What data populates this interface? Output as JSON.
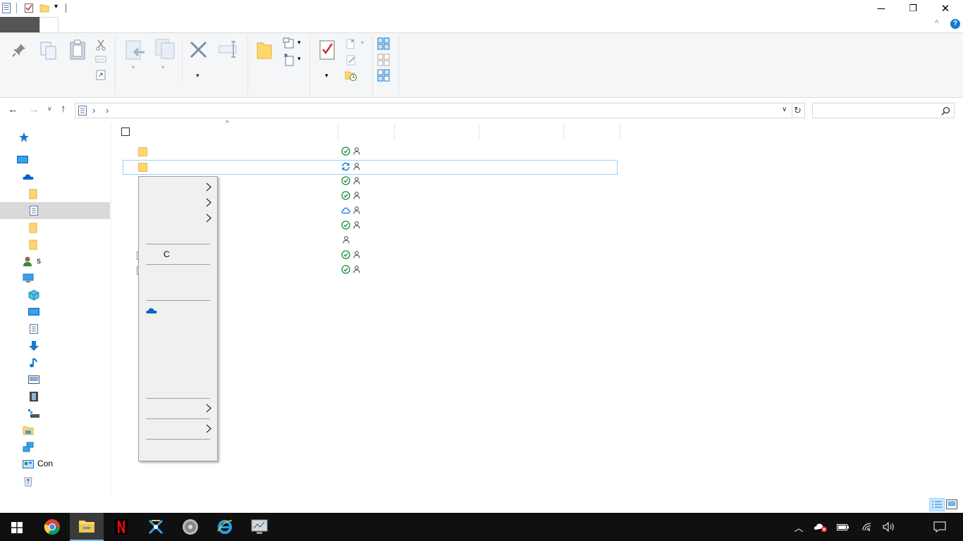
{
  "window": {
    "minimize_glyph": "─",
    "restore_glyph": "❐",
    "close_glyph": "✕",
    "help_glyph": "?",
    "ribbon_collapse_glyph": "^"
  },
  "address": {
    "chevron1": "›",
    "chevron2": "›",
    "dropdown_glyph": "∨",
    "refresh_glyph": "↻"
  },
  "nav": {
    "back_glyph": "←",
    "forward_glyph": "→",
    "recent_glyph": "∨",
    "up_glyph": "↑",
    "items": [
      {
        "label": "",
        "icon": "quick-access-pin-icon"
      },
      {
        "label": "",
        "icon": "desktop-icon"
      },
      {
        "label": "",
        "icon": "onedrive-icon"
      },
      {
        "label": "",
        "icon": "folder-icon"
      },
      {
        "label": "",
        "icon": "document-icon"
      },
      {
        "label": "",
        "icon": "folder-icon"
      },
      {
        "label": "",
        "icon": "folder-icon"
      },
      {
        "label": "s",
        "icon": "user-icon"
      },
      {
        "label": "",
        "icon": "this-pc-icon"
      },
      {
        "label": "",
        "icon": "3d-objects-icon"
      },
      {
        "label": "",
        "icon": "desktop-icon"
      },
      {
        "label": "",
        "icon": "documents-icon"
      },
      {
        "label": "",
        "icon": "downloads-icon"
      },
      {
        "label": "",
        "icon": "music-icon"
      },
      {
        "label": "",
        "icon": "pictures-icon"
      },
      {
        "label": "",
        "icon": "videos-icon"
      },
      {
        "label": "",
        "icon": "local-disk-icon"
      },
      {
        "label": "",
        "icon": "libraries-icon"
      },
      {
        "label": "",
        "icon": "network-icon"
      },
      {
        "label": "Con",
        "icon": "control-panel-icon"
      },
      {
        "label": "",
        "icon": "recycle-bin-icon"
      }
    ]
  },
  "list": {
    "sort_glyph": "^",
    "rows": [
      {
        "status": "synced"
      },
      {
        "status": "syncing"
      },
      {
        "status": "synced"
      },
      {
        "status": "synced"
      },
      {
        "status": "cloud"
      },
      {
        "status": "synced"
      },
      {
        "status": "none"
      },
      {
        "status": "synced"
      },
      {
        "status": "synced"
      }
    ]
  },
  "context_menu": {
    "item_c": "C"
  },
  "colors": {
    "accent": "#0078d7",
    "sync_green": "#1e8e3e",
    "taskbar": "#101010",
    "selection_border": "#99d1ff"
  }
}
